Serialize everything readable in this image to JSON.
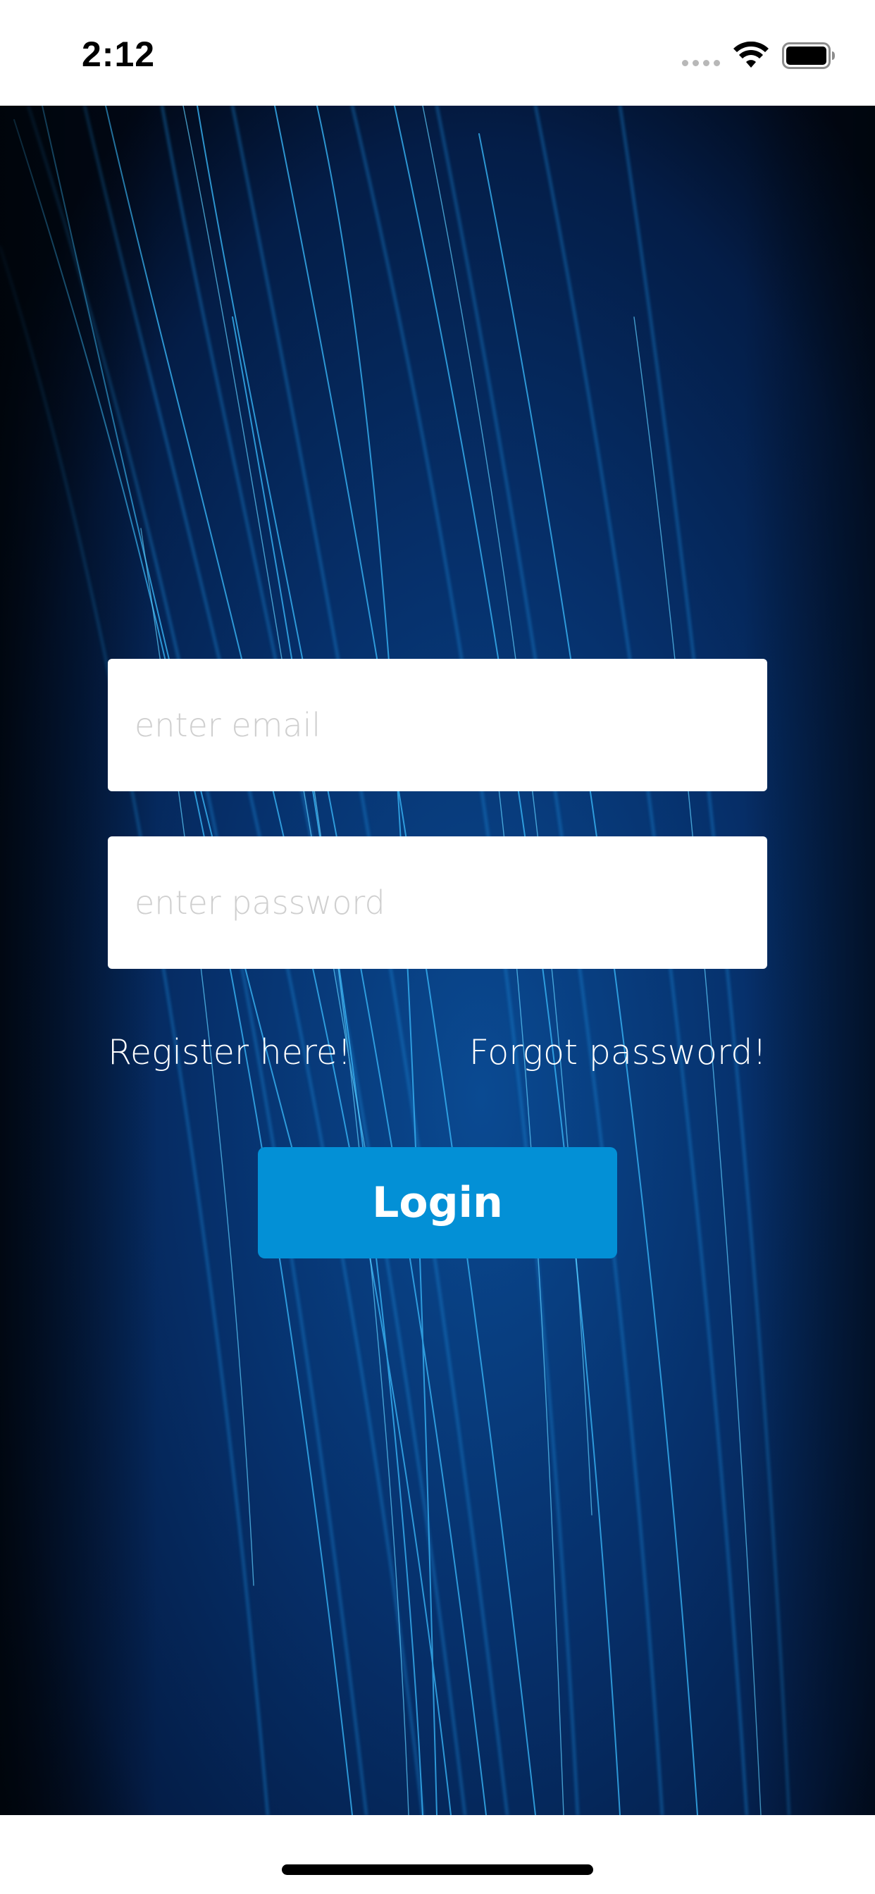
{
  "status_bar": {
    "time": "2:12"
  },
  "login_form": {
    "email": {
      "placeholder": "enter email",
      "value": ""
    },
    "password": {
      "placeholder": "enter password",
      "value": ""
    },
    "register_link": "Register here!",
    "forgot_link": "Forgot password!",
    "login_button": "Login"
  },
  "theme": {
    "background": "#020e2b",
    "accent": "#0390d6",
    "link_color": "#ffffff"
  }
}
